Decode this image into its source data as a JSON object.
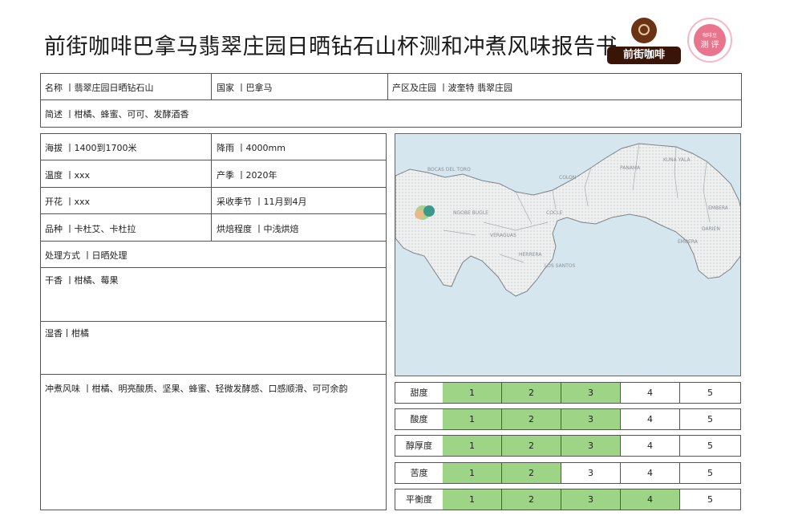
{
  "title": "前街咖啡巴拿马翡翠庄园日晒钻石山杯测和冲煮风味报告书",
  "logos": {
    "brand_left": "前街咖啡",
    "badge_top": "咖啡豆",
    "badge_main": "测 评"
  },
  "info": {
    "name": "名称 丨翡翠庄园日晒钻石山",
    "country": "国家 丨巴拿马",
    "region": "产区及庄园 丨波奎特 翡翠庄园",
    "summary": "简述 丨柑橘、蜂蜜、可可、发酵酒香",
    "altitude": "海拔 丨1400到1700米",
    "rainfall": "降雨 丨4000mm",
    "temperature": "温度 丨xxx",
    "season": "产季 丨2020年",
    "flowering": "开花 丨xxx",
    "harvest": "采收季节 丨11月到4月",
    "variety": "品种 丨卡杜艾、卡杜拉",
    "roast": "烘焙程度 丨中浅烘焙",
    "process": "处理方式 丨日晒处理",
    "dry_aroma": "干香 丨柑橘、莓果",
    "wet_aroma": "湿香丨柑橘",
    "brew_flavor": "冲煮风味 丨柑橘、明亮酸质、坚果、蜂蜜、轻微发酵感、口感顺滑、可可余韵"
  },
  "map": {
    "labels": [
      "BOCAS DEL TORO",
      "COLON",
      "PANAMA",
      "KUNA YALA",
      "EMBERA",
      "DARIEN",
      "EMBERA",
      "NGOBE BUGLE",
      "COCLE",
      "VERAGUAS",
      "HERRERA",
      "LOS SANTOS"
    ]
  },
  "ratings": [
    {
      "label": "甜度",
      "level": 3
    },
    {
      "label": "酸度",
      "level": 3
    },
    {
      "label": "醇厚度",
      "level": 3
    },
    {
      "label": "苦度",
      "level": 2
    },
    {
      "label": "平衡度",
      "level": 4
    }
  ],
  "scale": [
    "1",
    "2",
    "3",
    "4",
    "5"
  ],
  "colors": {
    "highlight": "#9dd485",
    "map_sea": "#d5e6ef",
    "map_land": "#f1f3f3"
  }
}
